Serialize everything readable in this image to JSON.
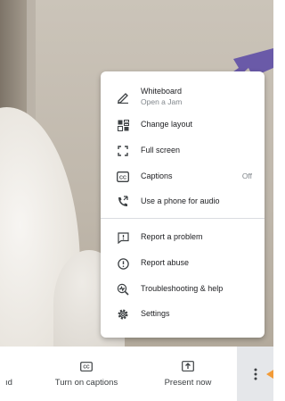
{
  "menu": {
    "items": [
      {
        "icon": "pen-icon",
        "label": "Whiteboard",
        "sub": "Open a Jam"
      },
      {
        "icon": "layout-icon",
        "label": "Change layout"
      },
      {
        "icon": "fullscreen-icon",
        "label": "Full screen"
      },
      {
        "icon": "cc-icon",
        "label": "Captions",
        "value": "Off"
      },
      {
        "icon": "phone-audio-icon",
        "label": "Use a phone for audio"
      },
      {
        "icon": "report-problem-icon",
        "label": "Report a problem"
      },
      {
        "icon": "report-abuse-icon",
        "label": "Report abuse"
      },
      {
        "icon": "troubleshoot-icon",
        "label": "Troubleshooting & help"
      },
      {
        "icon": "settings-icon",
        "label": "Settings"
      }
    ]
  },
  "bottom_bar": {
    "partial_label": "ıd",
    "captions_label": "Turn on captions",
    "present_label": "Present now",
    "more_icon": "more-vert-icon"
  },
  "colors": {
    "arrow": "#6a5aa8",
    "more_bg": "#e5e7ea",
    "more_dots": "#3c4043",
    "arrow_accent": "#f29b38"
  }
}
